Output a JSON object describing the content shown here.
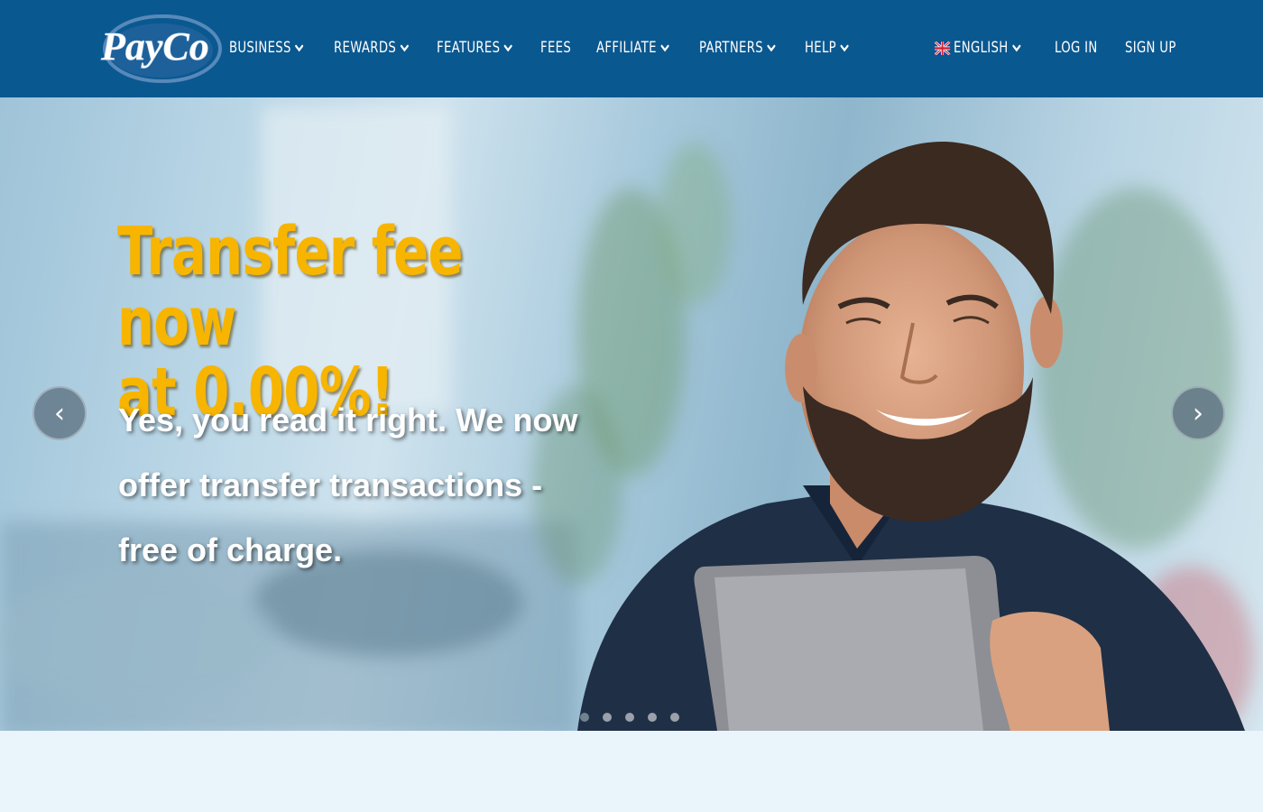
{
  "brand": {
    "name": "PayCo"
  },
  "nav": {
    "items": [
      {
        "label": "BUSINESS",
        "dropdown": true
      },
      {
        "label": "REWARDS",
        "dropdown": true
      },
      {
        "label": "FEATURES",
        "dropdown": true
      },
      {
        "label": "FEES",
        "dropdown": false
      },
      {
        "label": "AFFILIATE",
        "dropdown": true
      },
      {
        "label": "PARTNERS",
        "dropdown": true
      },
      {
        "label": "HELP",
        "dropdown": true
      }
    ],
    "language": {
      "label": "ENGLISH",
      "flag_icon": "uk-flag-icon"
    },
    "login": "LOG IN",
    "signup": "SIGN UP"
  },
  "hero": {
    "headline_line1": "Transfer fee now",
    "headline_line2": "at 0.00%!",
    "sub_line1": "Yes, you read it right. We now",
    "sub_line2": "offer transfer transactions -",
    "sub_line3": "free of charge.",
    "prev_arrow": "‹",
    "next_arrow": "›",
    "slides_total": 5,
    "active_slide": 1
  },
  "colors": {
    "nav_bg": "#0a5890",
    "headline": "#f7b500",
    "page_bg": "#eaf4fb"
  }
}
